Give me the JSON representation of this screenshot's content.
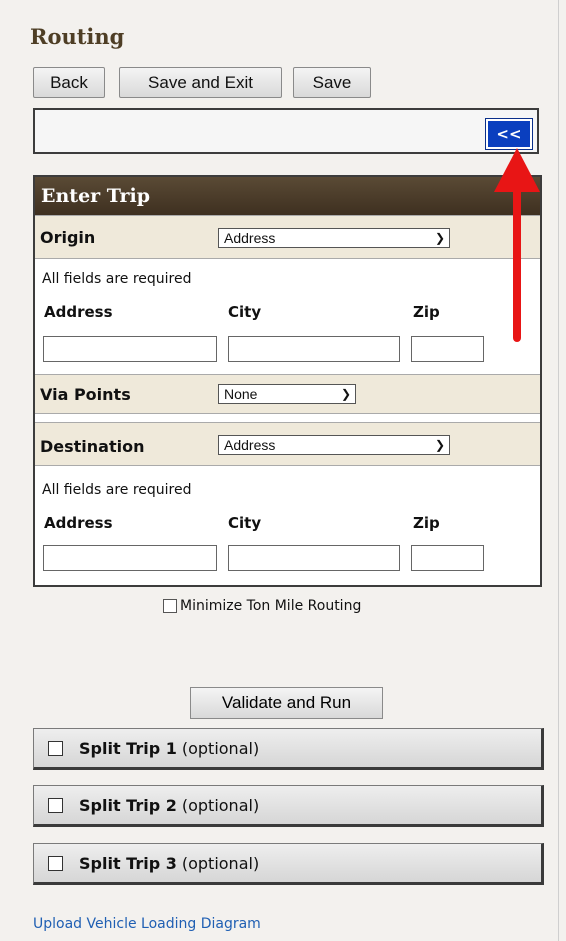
{
  "header": {
    "title": "Routing"
  },
  "toolbar": {
    "back_label": "Back",
    "save_exit_label": "Save and Exit",
    "save_label": "Save"
  },
  "collapse_button": {
    "label": "<<",
    "icon": "double-chevron-left-icon"
  },
  "trip": {
    "title": "Enter Trip",
    "origin": {
      "label": "Origin",
      "type_selected": "Address",
      "required_note": "All fields are required",
      "columns": [
        "Address",
        "City",
        "Zip"
      ],
      "values": [
        "",
        "",
        ""
      ]
    },
    "via": {
      "label": "Via Points",
      "selected": "None"
    },
    "destination": {
      "label": "Destination",
      "type_selected": "Address",
      "required_note": "All fields are required",
      "columns": [
        "Address",
        "City",
        "Zip"
      ],
      "values": [
        "",
        "",
        ""
      ]
    }
  },
  "options": {
    "minimize_label": "Minimize Ton Mile Routing",
    "minimize_checked": false
  },
  "validate_label": "Validate and Run",
  "splits": [
    {
      "name": "Split Trip 1",
      "suffix": "(optional)",
      "checked": false
    },
    {
      "name": "Split Trip 2",
      "suffix": "(optional)",
      "checked": false
    },
    {
      "name": "Split Trip 3",
      "suffix": "(optional)",
      "checked": false
    }
  ],
  "footer": {
    "upload_link": "Upload Vehicle Loading Diagram"
  },
  "colors": {
    "header_bar": "#4e3e25",
    "section_bg": "#efe9da",
    "link": "#1f5fb3",
    "annotation_arrow": "#e81515",
    "collapse_btn": "#0a3fbf"
  }
}
